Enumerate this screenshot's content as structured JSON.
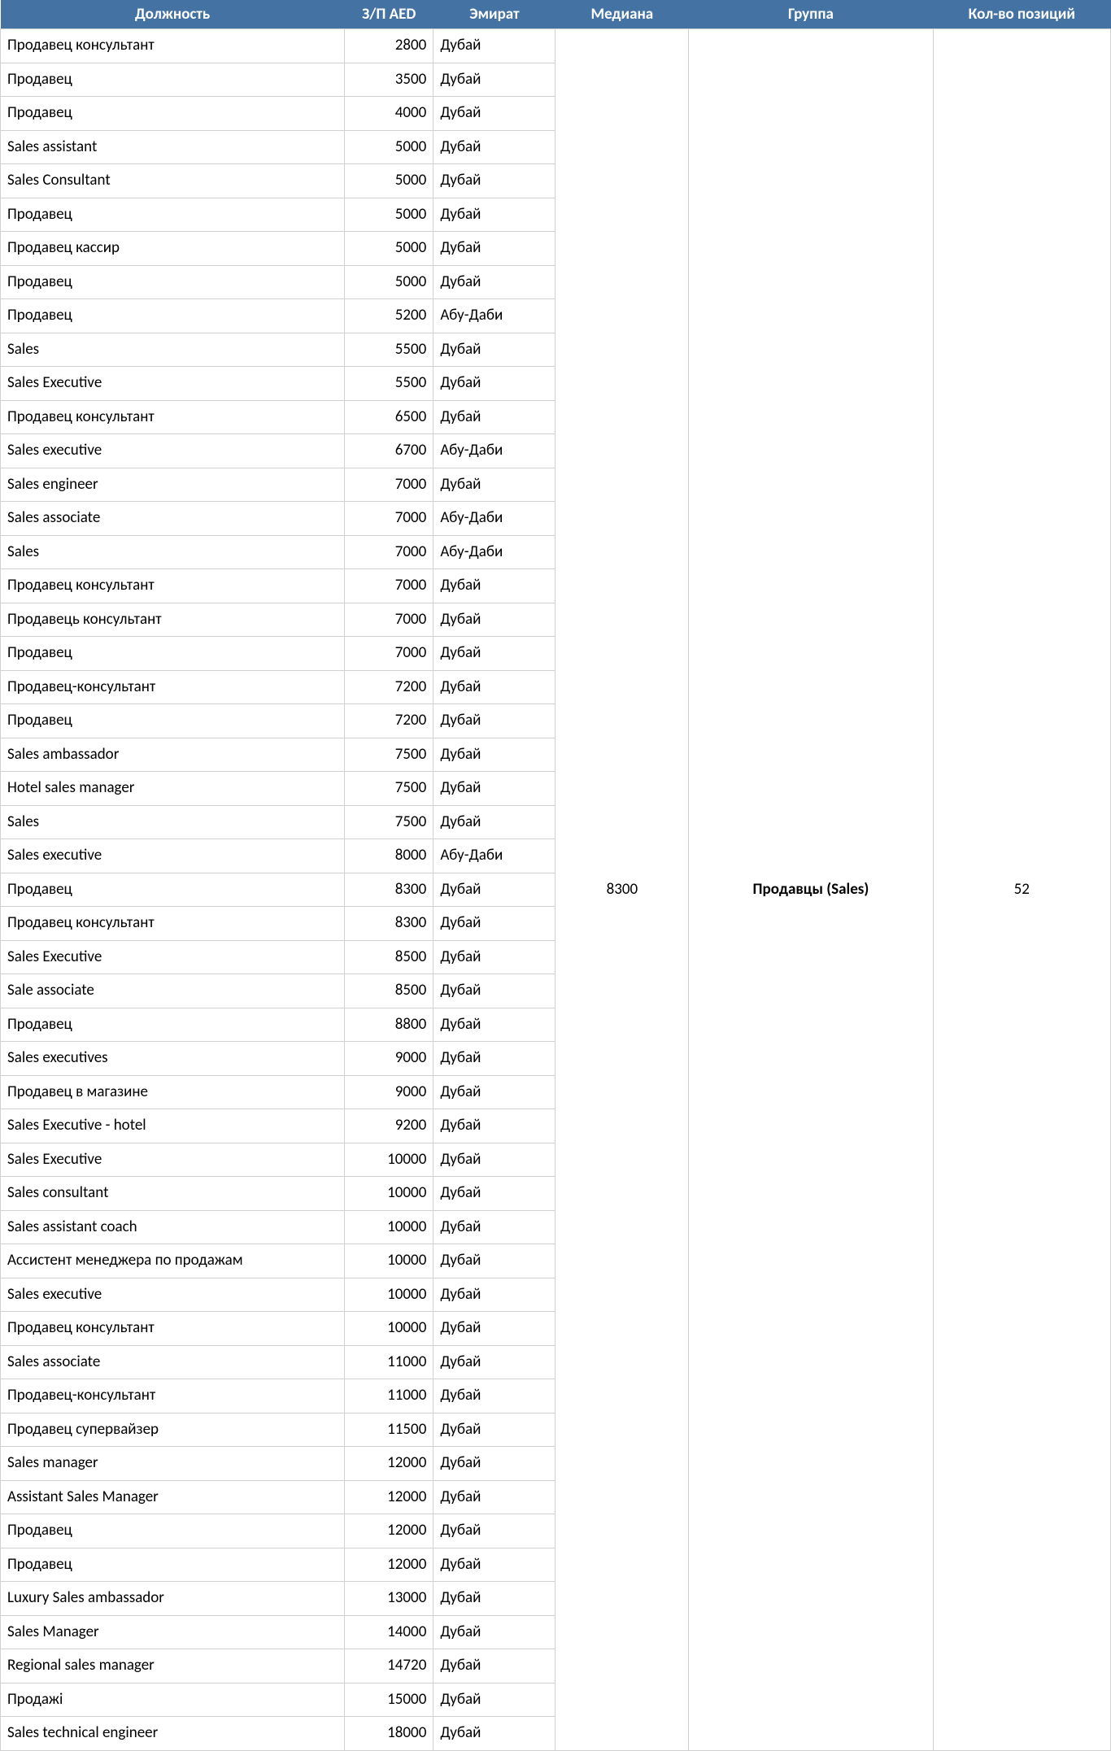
{
  "headers": {
    "position": "Должность",
    "salary": "З/П AED",
    "emirate": "Эмират",
    "median": "Медиана",
    "group": "Группа",
    "count": "Кол-во позиций"
  },
  "median": "8300",
  "group": "Продавцы (Sales)",
  "count": "52",
  "rows": [
    {
      "position": "Продавец консультант",
      "salary": "2800",
      "emirate": "Дубай"
    },
    {
      "position": "Продавец",
      "salary": "3500",
      "emirate": "Дубай"
    },
    {
      "position": "Продавец",
      "salary": "4000",
      "emirate": "Дубай"
    },
    {
      "position": "Sales assistant",
      "salary": "5000",
      "emirate": "Дубай"
    },
    {
      "position": "Sales Consultant",
      "salary": "5000",
      "emirate": "Дубай"
    },
    {
      "position": "Продавец",
      "salary": "5000",
      "emirate": "Дубай"
    },
    {
      "position": "Продавец кассир",
      "salary": "5000",
      "emirate": "Дубай"
    },
    {
      "position": "Продавец",
      "salary": "5000",
      "emirate": "Дубай"
    },
    {
      "position": "Продавец",
      "salary": "5200",
      "emirate": "Абу-Даби"
    },
    {
      "position": "Sales",
      "salary": "5500",
      "emirate": "Дубай"
    },
    {
      "position": "Sales Executive",
      "salary": "5500",
      "emirate": "Дубай"
    },
    {
      "position": "Продавец консультант",
      "salary": "6500",
      "emirate": "Дубай"
    },
    {
      "position": "Sales executive",
      "salary": "6700",
      "emirate": "Абу-Даби"
    },
    {
      "position": "Sales engineer",
      "salary": "7000",
      "emirate": "Дубай"
    },
    {
      "position": "Sales associate",
      "salary": "7000",
      "emirate": "Абу-Даби"
    },
    {
      "position": "Sales",
      "salary": "7000",
      "emirate": "Абу-Даби"
    },
    {
      "position": "Продавец консультант",
      "salary": "7000",
      "emirate": "Дубай"
    },
    {
      "position": "Продавець консультант",
      "salary": "7000",
      "emirate": "Дубай"
    },
    {
      "position": "Продавец",
      "salary": "7000",
      "emirate": "Дубай"
    },
    {
      "position": "Продавец-консультант",
      "salary": "7200",
      "emirate": "Дубай"
    },
    {
      "position": "Продавец",
      "salary": "7200",
      "emirate": "Дубай"
    },
    {
      "position": "Sales ambassador",
      "salary": "7500",
      "emirate": "Дубай"
    },
    {
      "position": "Hotel sales manager",
      "salary": "7500",
      "emirate": "Дубай"
    },
    {
      "position": "Sales",
      "salary": "7500",
      "emirate": "Дубай"
    },
    {
      "position": "Sales executive",
      "salary": "8000",
      "emirate": "Абу-Даби"
    },
    {
      "position": "Продавец",
      "salary": "8300",
      "emirate": "Дубай"
    },
    {
      "position": "Продавец консультант",
      "salary": "8300",
      "emirate": "Дубай"
    },
    {
      "position": "Sales Executive",
      "salary": "8500",
      "emirate": "Дубай"
    },
    {
      "position": "Sale associate",
      "salary": "8500",
      "emirate": "Дубай"
    },
    {
      "position": "Продавец",
      "salary": "8800",
      "emirate": "Дубай"
    },
    {
      "position": "Sales executives",
      "salary": "9000",
      "emirate": "Дубай"
    },
    {
      "position": "Продавец в магазине",
      "salary": "9000",
      "emirate": "Дубай"
    },
    {
      "position": "Sales Executive - hotel",
      "salary": "9200",
      "emirate": "Дубай"
    },
    {
      "position": "Sales Executive",
      "salary": "10000",
      "emirate": "Дубай"
    },
    {
      "position": "Sales consultant",
      "salary": "10000",
      "emirate": "Дубай"
    },
    {
      "position": "Sales assistant coach",
      "salary": "10000",
      "emirate": "Дубай"
    },
    {
      "position": "Ассистент менеджера по продажам",
      "salary": "10000",
      "emirate": "Дубай"
    },
    {
      "position": "Sales executive",
      "salary": "10000",
      "emirate": "Дубай"
    },
    {
      "position": "Продавец консультант",
      "salary": "10000",
      "emirate": "Дубай"
    },
    {
      "position": "Sales associate",
      "salary": "11000",
      "emirate": "Дубай"
    },
    {
      "position": "Продавец-консультант",
      "salary": "11000",
      "emirate": "Дубай"
    },
    {
      "position": "Продавец супервайзер",
      "salary": "11500",
      "emirate": "Дубай"
    },
    {
      "position": "Sales manager",
      "salary": "12000",
      "emirate": "Дубай"
    },
    {
      "position": "Assistant Sales Manager",
      "salary": "12000",
      "emirate": "Дубай"
    },
    {
      "position": "Продавец",
      "salary": "12000",
      "emirate": "Дубай"
    },
    {
      "position": "Продавец",
      "salary": "12000",
      "emirate": "Дубай"
    },
    {
      "position": "Luxury Sales ambassador",
      "salary": "13000",
      "emirate": "Дубай"
    },
    {
      "position": "Sales Manager",
      "salary": "14000",
      "emirate": "Дубай"
    },
    {
      "position": "Regional sales manager",
      "salary": "14720",
      "emirate": "Дубай"
    },
    {
      "position": "Продажі",
      "salary": "15000",
      "emirate": "Дубай"
    },
    {
      "position": "Sales technical engineer",
      "salary": "18000",
      "emirate": "Дубай"
    }
  ]
}
